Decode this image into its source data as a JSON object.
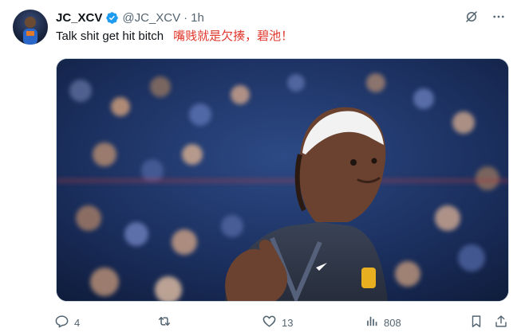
{
  "tweet": {
    "display_name": "JC_XCV",
    "handle": "@JC_XCV",
    "separator": "·",
    "time": "1h",
    "text_en": "Talk shit get hit bitch",
    "text_zh": "嘴贱就是欠揍，碧池！",
    "verified": true
  },
  "icons": {
    "verified": "verified-badge-icon",
    "grok": "grok-icon",
    "more": "more-icon",
    "reply": "reply-icon",
    "retweet": "retweet-icon",
    "like": "heart-icon",
    "views": "views-icon",
    "bookmark": "bookmark-icon",
    "share": "share-icon"
  },
  "actions": {
    "reply_count": "4",
    "retweet_count": "",
    "like_count": "13",
    "views_count": "808"
  },
  "colors": {
    "accent": "#1d9bf0",
    "muted": "#536471",
    "text": "#0f1419",
    "highlight": "#e0362b"
  }
}
